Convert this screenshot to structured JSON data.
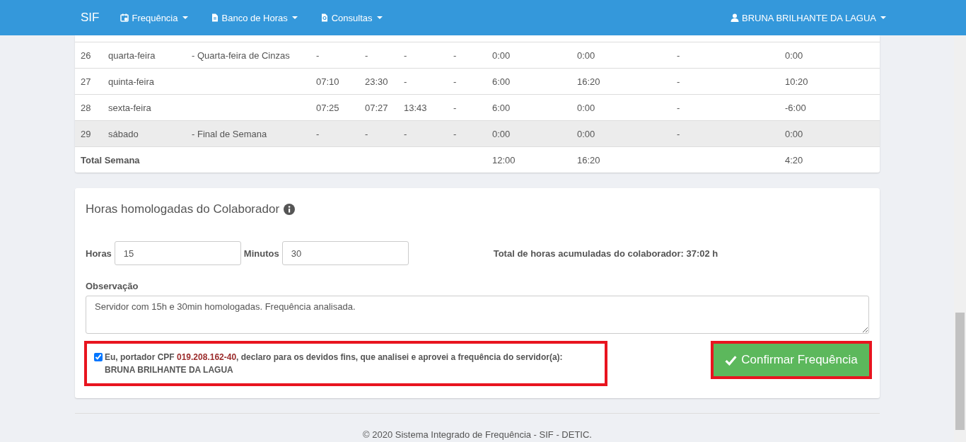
{
  "navbar": {
    "brand": "SIF",
    "menus": [
      {
        "label": "Frequência",
        "kind": "calendar"
      },
      {
        "label": "Banco de Horas",
        "kind": "document"
      },
      {
        "label": "Consultas",
        "kind": "query"
      }
    ],
    "user": "BRUNA BRILHANTE DA LAGUA"
  },
  "table": {
    "rows": [
      {
        "cells": [
          "26",
          "quarta-feira",
          "- Quarta-feira de Cinzas",
          "-",
          "-",
          "-",
          "-",
          "0:00",
          "0:00",
          "-",
          "0:00"
        ],
        "shaded": false
      },
      {
        "cells": [
          "27",
          "quinta-feira",
          "",
          "07:10",
          "23:30",
          "-",
          "-",
          "6:00",
          "16:20",
          "-",
          "10:20"
        ],
        "shaded": false
      },
      {
        "cells": [
          "28",
          "sexta-feira",
          "",
          "07:25",
          "07:27",
          "13:43",
          "-",
          "6:00",
          "0:00",
          "-",
          "-6:00"
        ],
        "shaded": false
      },
      {
        "cells": [
          "29",
          "sábado",
          "- Final de Semana",
          "-",
          "-",
          "-",
          "-",
          "0:00",
          "0:00",
          "-",
          "0:00"
        ],
        "shaded": true
      }
    ],
    "total": {
      "label": "Total Semana",
      "cells": [
        "12:00",
        "16:20",
        "",
        "4:20"
      ]
    }
  },
  "form": {
    "title": "Horas homologadas do Colaborador",
    "hours_label": "Horas",
    "hours_value": "15",
    "minutes_label": "Minutos",
    "minutes_value": "30",
    "accumulated": "Total de horas acumuladas do colaborador: 37:02 h",
    "observation_label": "Observação",
    "observation_value": "Servidor com 15h e 30min homologadas. Frequência analisada.",
    "declaration": {
      "checked": true,
      "highlighted": true,
      "text_before": "Eu, portador CPF ",
      "cpf": "019.208.162-40",
      "text_after": ", declaro para os devidos fins, que analisei e aprovei a frequência do servidor(a):",
      "name": "BRUNA BRILHANTE DA LAGUA"
    },
    "confirm_button": {
      "label": "Confirmar Frequência",
      "highlighted": true
    }
  },
  "footer": "© 2020 Sistema Integrado de Frequência - SIF - DETIC."
}
